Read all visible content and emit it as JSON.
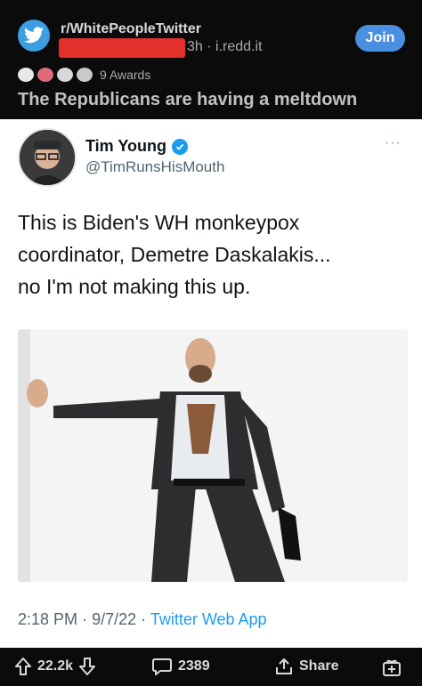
{
  "reddit": {
    "subreddit": "r/WhitePeopleTwitter",
    "time": "3h",
    "domain": "i.redd.it",
    "meta_separator": "·",
    "join_label": "Join",
    "awards_label": "9 Awards",
    "post_title": "The Republicans are having a meltdown"
  },
  "tweet": {
    "name": "Tim Young",
    "handle": "@TimRunsHisMouth",
    "more": "···",
    "text": "This is Biden's WH monkeypox\ncoordinator,  Demetre Daskalakis...\nno I'm not making this up.",
    "time": "2:18 PM",
    "date": "9/7/22",
    "app": "Twitter Web App",
    "sep": "·"
  },
  "bottom_bar": {
    "upvotes": "22.2k",
    "comments": "2389",
    "share_label": "Share"
  },
  "colors": {
    "join": "#4a8fe0",
    "verified": "#1d9bf0",
    "redaction": "#e4302a",
    "subreddit_icon": "#3f9ee0"
  },
  "icons": [
    "twitter-bird-icon",
    "award-icons",
    "verified-badge-icon",
    "more-dots-icon",
    "upvote-arrow-icon",
    "downvote-arrow-icon",
    "comment-bubble-icon",
    "share-icon",
    "add-award-icon"
  ]
}
